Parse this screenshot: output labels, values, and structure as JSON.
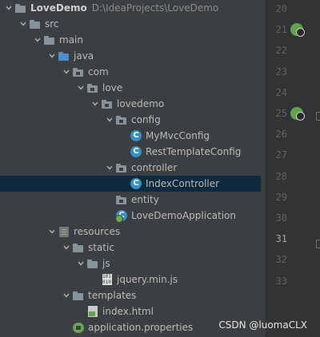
{
  "project": {
    "name": "LoveDemo",
    "path": "D:\\IdeaProjects\\LoveDemo"
  },
  "tree": [
    {
      "id": "src",
      "label": "src",
      "depth": 1,
      "icon": "folder",
      "expanded": true
    },
    {
      "id": "main",
      "label": "main",
      "depth": 2,
      "icon": "folder",
      "expanded": true
    },
    {
      "id": "java",
      "label": "java",
      "depth": 3,
      "icon": "source-folder",
      "expanded": true
    },
    {
      "id": "com",
      "label": "com",
      "depth": 4,
      "icon": "package",
      "expanded": true
    },
    {
      "id": "love",
      "label": "love",
      "depth": 5,
      "icon": "package",
      "expanded": true
    },
    {
      "id": "lovedemo",
      "label": "lovedemo",
      "depth": 6,
      "icon": "package",
      "expanded": true
    },
    {
      "id": "config",
      "label": "config",
      "depth": 7,
      "icon": "package",
      "expanded": true
    },
    {
      "id": "mymvcconfig",
      "label": "MyMvcConfig",
      "depth": 8,
      "icon": "class",
      "leaf": true
    },
    {
      "id": "resttemplateconfig",
      "label": "RestTemplateConfig",
      "depth": 8,
      "icon": "class",
      "leaf": true
    },
    {
      "id": "controller",
      "label": "controller",
      "depth": 7,
      "icon": "package",
      "expanded": true
    },
    {
      "id": "indexcontroller",
      "label": "IndexController",
      "depth": 8,
      "icon": "class",
      "leaf": true,
      "selected": true
    },
    {
      "id": "entity",
      "label": "entity",
      "depth": 7,
      "icon": "package",
      "leaf": true
    },
    {
      "id": "lovedemoapplication",
      "label": "LoveDemoApplication",
      "depth": 7,
      "icon": "spring-class",
      "leaf": true
    },
    {
      "id": "resources",
      "label": "resources",
      "depth": 3,
      "icon": "resources-folder",
      "expanded": true
    },
    {
      "id": "static",
      "label": "static",
      "depth": 4,
      "icon": "folder",
      "expanded": true
    },
    {
      "id": "js",
      "label": "js",
      "depth": 5,
      "icon": "folder",
      "expanded": true
    },
    {
      "id": "jquery",
      "label": "jquery.min.js",
      "depth": 6,
      "icon": "js-file",
      "leaf": true
    },
    {
      "id": "templates",
      "label": "templates",
      "depth": 4,
      "icon": "folder",
      "expanded": true
    },
    {
      "id": "indexhtml",
      "label": "index.html",
      "depth": 5,
      "icon": "html-file",
      "leaf": true
    },
    {
      "id": "appprops",
      "label": "application.properties",
      "depth": 4,
      "icon": "properties-file",
      "leaf": true
    }
  ],
  "gutter": {
    "line_numbers": [
      "20",
      "21",
      "22",
      "23",
      "24",
      "25",
      "26",
      "27",
      "28",
      "29",
      "30",
      "31",
      "32",
      "33"
    ],
    "current_line": "31",
    "run_icon_lines": [
      "21",
      "25"
    ]
  },
  "watermark": "CSDN @luomaCLX"
}
